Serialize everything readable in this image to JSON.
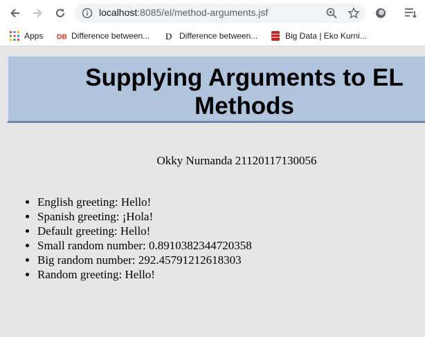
{
  "browser": {
    "url_host": "localhost",
    "url_rest": ":8085/el/method-arguments.jsf",
    "bookmarks": [
      {
        "label": "Apps",
        "icon": "apps-grid-icon"
      },
      {
        "label": "Difference between...",
        "icon": "db-logo-icon"
      },
      {
        "label": "Difference between...",
        "icon": "d-logo-icon"
      },
      {
        "label": "Big Data | Eko Kurni...",
        "icon": "database-icon"
      }
    ]
  },
  "page": {
    "title": "Supplying Arguments to EL Methods",
    "author": "Okky Nurnanda 21120117130056",
    "items": [
      "English greeting: Hello!",
      "Spanish greeting: ¡Hola!",
      "Default greeting: Hello!",
      "Small random number: 0.8910382344720358",
      "Big random number: 292.45791212618303",
      "Random greeting: Hello!"
    ]
  },
  "colors": {
    "page_background": "#e6e6e6",
    "title_background": "#b0c4de"
  }
}
